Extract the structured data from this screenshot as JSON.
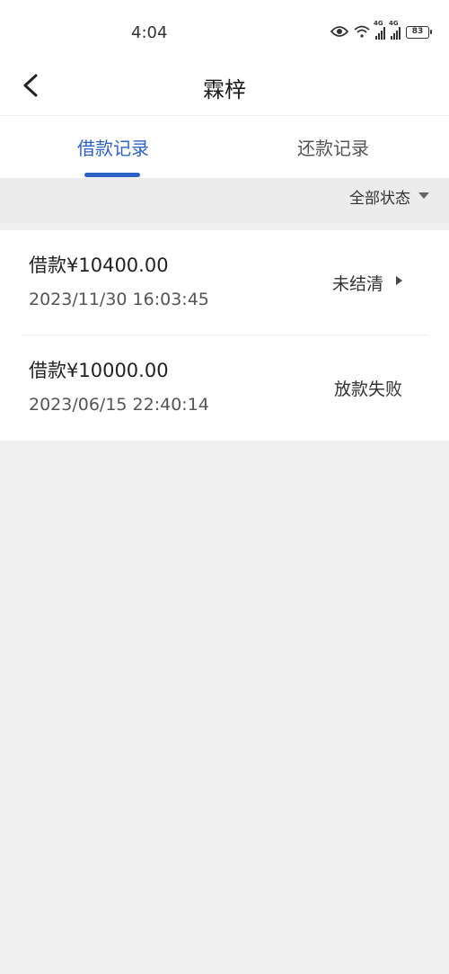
{
  "status_bar": {
    "time": "4:04",
    "battery": "83",
    "signal_tags": [
      "4G",
      "4G"
    ],
    "icons": [
      "eye-icon",
      "wifi-icon",
      "signal-icon",
      "signal-icon",
      "battery-icon"
    ]
  },
  "header": {
    "title": "霖梓",
    "back_icon": "chevron-left-icon"
  },
  "tabs": [
    {
      "label": "借款记录",
      "active": true
    },
    {
      "label": "还款记录",
      "active": false
    }
  ],
  "filter": {
    "label": "全部状态",
    "icon": "caret-down-icon"
  },
  "records": [
    {
      "amount": "借款¥10400.00",
      "datetime": "2023/11/30 16:03:45",
      "status": "未结清",
      "has_arrow": true
    },
    {
      "amount": "借款¥10000.00",
      "datetime": "2023/06/15 22:40:14",
      "status": "放款失败",
      "has_arrow": false
    }
  ],
  "colors": {
    "accent": "#2d63c8",
    "background": "#f0f0f0"
  }
}
